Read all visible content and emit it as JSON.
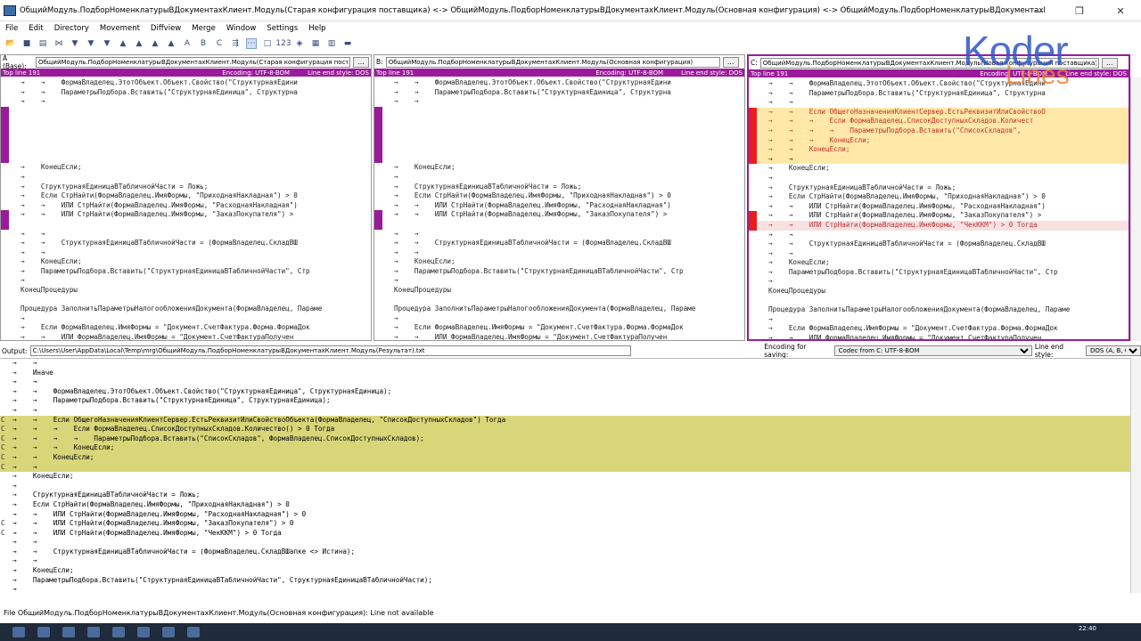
{
  "window": {
    "title": "ОбщийМодуль.ПодборНоменклатурыВДокументахКлиент.Модуль(Старая конфигурация поставщика) <-> ОбщийМодуль.ПодборНоменклатурыВДокументахКлиент.Модуль(Основная конфигурация) <-> ОбщийМодуль.ПодборНоменклатурыВДокументахКлиент.Модуль(Новая конфигурация поставщи",
    "min": "—",
    "max": "❐",
    "close": "✕"
  },
  "menu": [
    "File",
    "Edit",
    "Directory",
    "Movement",
    "Diffview",
    "Merge",
    "Window",
    "Settings",
    "Help"
  ],
  "panes": {
    "a": {
      "label": "A (Base):",
      "file": "ОбщийМодуль.ПодборНоменклатурыВДокументахКлиент.Модуль(Старая конфигурация поставщика)",
      "topline": "Top line 191",
      "encoding": "Encoding: UTF-8-BOM",
      "lineend": "Line end style: DOS",
      "color": "#9b1a9b"
    },
    "b": {
      "label": "B:",
      "file": "ОбщийМодуль.ПодборНоменклатурыВДокументахКлиент.Модуль(Основная конфигурация)",
      "topline": "Top line 191",
      "encoding": "Encoding: UTF-8-BOM",
      "lineend": "Line end style: DOS",
      "color": "#9b1a9b"
    },
    "c": {
      "label": "C:",
      "file": "ОбщийМодуль.ПодборНоменклатурыВДокументахКлиент.Модуль(Новая конфигурация поставщика)",
      "topline": "Top line 191",
      "encoding": "Encoding: UTF-8-BOM",
      "lineend": "Line end style: DOS",
      "color": "#9b1a9b"
    }
  },
  "code_ab": [
    "→    →    ФормаВладелец.ЭтотОбъект.Объект.Свойство(\"СтруктурнаяЕдини",
    "→    →    ПараметрыПодбора.Вставить(\"СтруктурнаяЕдиница\", Структурна",
    "→    →",
    "",
    "",
    "",
    "",
    "",
    "",
    "→    КонецЕсли;",
    "→",
    "→    СтруктурнаяЕдиницаВТабличнойЧасти = Ложь;",
    "→    Если СтрНайти(ФормаВладелец.ИмяФормы, \"ПриходнаяНакладная\") > 0",
    "→    →    ИЛИ СтрНайти(ФормаВладелец.ИмяФормы, \"РасходнаяНакладная\")",
    "→    →    ИЛИ СтрНайти(ФормаВладелец.ИмяФормы, \"ЗаказПокупателя\") >",
    "",
    "→    →",
    "→    →    СтруктурнаяЕдиницаВТабличнойЧасти = (ФормаВладелец.СкладВШ",
    "→    →",
    "→    КонецЕсли;",
    "→    ПараметрыПодбора.Вставить(\"СтруктурнаяЕдиницаВТабличнойЧасти\", Стр",
    "→",
    "КонецПроцедуры",
    "",
    "Процедура ЗаполнитьПараметрыНалогообложенияДокумента(ФормаВладелец, Параме",
    "→",
    "→    Если ФормаВладелец.ИмяФормы = \"Документ.СчетФактура.Форма.ФормаДок",
    "→    →    ИЛИ ФормаВладелец.ИмяФормы = \"Документ.СчетФактураПолучен"
  ],
  "code_c": [
    "→    →    ФормаВладелец.ЭтотОбъект.Объект.Свойство(\"СтруктурнаяЕдини",
    "→    →    ПараметрыПодбора.Вставить(\"СтруктурнаяЕдиница\", Структурна",
    "→    →",
    "→    →    Если ОбщегоНазначенияКлиентСервер.ЕстьРеквизитИлиСвойствоО",
    "→    →    →    Если ФормаВладелец.СписокДоступныхСкладов.Количест",
    "→    →    →    →    ПараметрыПодбора.Вставить(\"СписокСкладов\",",
    "→    →    →    КонецЕсли;",
    "→    →    КонецЕсли;",
    "→    →",
    "→    КонецЕсли;",
    "→",
    "→    СтруктурнаяЕдиницаВТабличнойЧасти = Ложь;",
    "→    Если СтрНайти(ФормаВладелец.ИмяФормы, \"ПриходнаяНакладная\") > 0",
    "→    →    ИЛИ СтрНайти(ФормаВладелец.ИмяФормы, \"РасходнаяНакладная\")",
    "→    →    ИЛИ СтрНайти(ФормаВладелец.ИмяФормы, \"ЗаказПокупателя\") >",
    "→    →    ИЛИ СтрНайти(ФормаВладелец.ИмяФормы, \"ЧекККМ\") > 0 Тогда",
    "→    →",
    "→    →    СтруктурнаяЕдиницаВТабличнойЧасти = (ФормаВладелец.СкладВШ",
    "→    →",
    "→    КонецЕсли;",
    "→    ПараметрыПодбора.Вставить(\"СтруктурнаяЕдиницаВТабличнойЧасти\", Стр",
    "→",
    "КонецПроцедуры",
    "",
    "Процедура ЗаполнитьПараметрыНалогообложенияДокумента(ФормаВладелец, Параме",
    "→",
    "→    Если ФормаВладелец.ИмяФормы = \"Документ.СчетФактура.Форма.ФормаДок",
    "→    →    ИЛИ ФормаВладелец.ИмяФормы = \"Документ.СчетФактураПолучен"
  ],
  "output": {
    "label": "Output:",
    "path": "C:\\Users\\User\\AppData\\Local\\Temp\\mrg\\ОбщийМодуль.ПодборНоменклатурыВДокументахКлиент.Модуль(Результат).txt",
    "enc_label": "Encoding for saving:",
    "enc_value": "Codec from C: UTF-8-BOM",
    "le_label": "Line end style:",
    "le_value": "DOS (A, B, C)",
    "lines": [
      {
        "m": "",
        "t": "→    →"
      },
      {
        "m": "",
        "t": "→    Иначе"
      },
      {
        "m": "",
        "t": "→    →"
      },
      {
        "m": "",
        "t": "→    →    ФормаВладелец.ЭтотОбъект.Объект.Свойство(\"СтруктурнаяЕдиница\", СтруктурнаяЕдиница);"
      },
      {
        "m": "",
        "t": "→    →    ПараметрыПодбора.Вставить(\"СтруктурнаяЕдиница\", СтруктурнаяЕдиница);"
      },
      {
        "m": "",
        "t": "→    →"
      },
      {
        "m": "C",
        "t": "→    →    Если ОбщегоНазначенияКлиентСервер.ЕстьРеквизитИлиСвойствоОбъекта(ФормаВладелец, \"СписокДоступныхСкладов\") Тогда",
        "hl": true
      },
      {
        "m": "C",
        "t": "→    →    →    Если ФормаВладелец.СписокДоступныхСкладов.Количество() > 0 Тогда",
        "hl": true
      },
      {
        "m": "C",
        "t": "→    →    →    →    ПараметрыПодбора.Вставить(\"СписокСкладов\", ФормаВладелец.СписокДоступныхСкладов);",
        "hl": true
      },
      {
        "m": "C",
        "t": "→    →    →    КонецЕсли;",
        "hl": true
      },
      {
        "m": "C",
        "t": "→    →    КонецЕсли;",
        "hl": true
      },
      {
        "m": "C",
        "t": "→    →",
        "hl": true
      },
      {
        "m": "",
        "t": "→    КонецЕсли;"
      },
      {
        "m": "",
        "t": "→"
      },
      {
        "m": "",
        "t": "→    СтруктурнаяЕдиницаВТабличнойЧасти = Ложь;"
      },
      {
        "m": "",
        "t": "→    Если СтрНайти(ФормаВладелец.ИмяФормы, \"ПриходнаяНакладная\") > 0"
      },
      {
        "m": "",
        "t": "→    →    ИЛИ СтрНайти(ФормаВладелец.ИмяФормы, \"РасходнаяНакладная\") > 0"
      },
      {
        "m": "C",
        "t": "→    →    ИЛИ СтрНайти(ФормаВладелец.ИмяФормы, \"ЗаказПокупателя\") > 0"
      },
      {
        "m": "C",
        "t": "→    →    ИЛИ СтрНайти(ФормаВладелец.ИмяФормы, \"ЧекККМ\") > 0 Тогда"
      },
      {
        "m": "",
        "t": "→    →"
      },
      {
        "m": "",
        "t": "→    →    СтруктурнаяЕдиницаВТабличнойЧасти = (ФормаВладелец.СкладВШапке <> Истина);"
      },
      {
        "m": "",
        "t": "→    →"
      },
      {
        "m": "",
        "t": "→    КонецЕсли;"
      },
      {
        "m": "",
        "t": "→    ПараметрыПодбора.Вставить(\"СтруктурнаяЕдиницаВТабличнойЧасти\", СтруктурнаяЕдиницаВТабличнойЧасти);"
      },
      {
        "m": "",
        "t": "→"
      }
    ]
  },
  "status": "File ОбщийМодуль.ПодборНоменклатурыВДокументахКлиент.Модуль(Основная конфигурация): Line not available",
  "clock": "22:40",
  "logo": {
    "top": "Koder",
    "bottom": "Lines"
  }
}
